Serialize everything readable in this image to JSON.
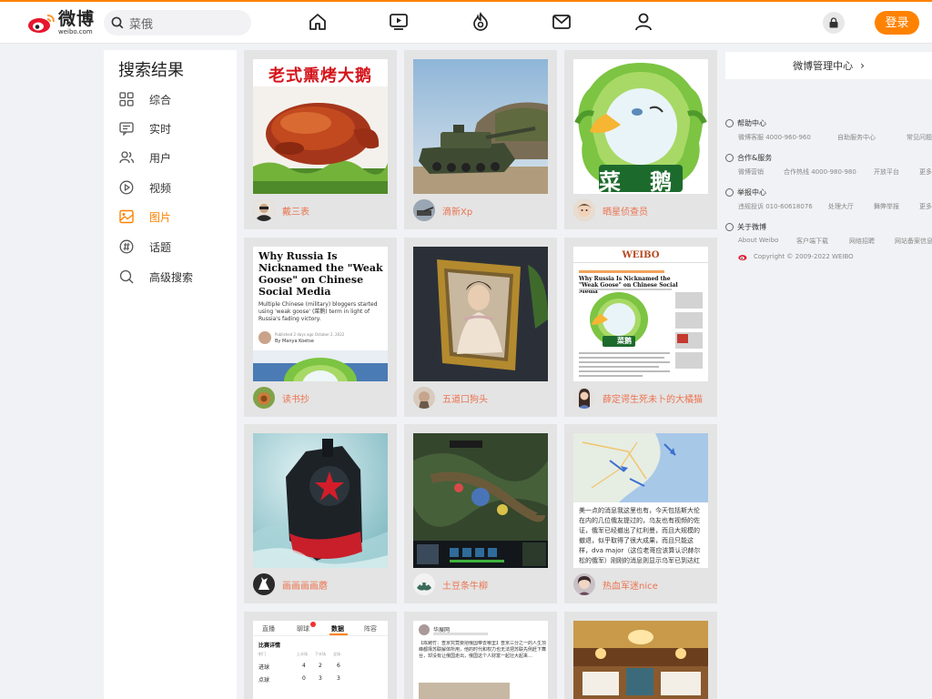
{
  "colors": {
    "accent": "#ff8200",
    "username": "#eb7350",
    "card_bg": "#e4e4e4"
  },
  "header": {
    "logo_cn": "微博",
    "logo_en": "weibo.com",
    "search_value": "菜俄",
    "nav_icons": [
      "home-icon",
      "video-icon",
      "hot-icon",
      "message-icon",
      "profile-icon"
    ],
    "login_label": "登录"
  },
  "sidebar": {
    "title": "搜索结果",
    "items": [
      {
        "label": "综合",
        "icon": "grid-icon"
      },
      {
        "label": "实时",
        "icon": "realtime-icon"
      },
      {
        "label": "用户",
        "icon": "users-icon"
      },
      {
        "label": "视频",
        "icon": "play-icon"
      },
      {
        "label": "图片",
        "icon": "image-icon",
        "active": true
      },
      {
        "label": "话题",
        "icon": "topic-icon"
      },
      {
        "label": "高级搜索",
        "icon": "advanced-search-icon"
      }
    ]
  },
  "results": [
    {
      "user": "戴三表",
      "image_text": "老式熏烤大鹅"
    },
    {
      "user": "滴新Xp"
    },
    {
      "user": "晒星侦查员",
      "image_text": "菜 鹅"
    },
    {
      "user": "读书抄",
      "image_title": "Why Russia Is Nicknamed the \"Weak Goose\" on Chinese Social Media",
      "image_body": "Multiple Chinese (military) bloggers started using 'weak goose' (菜鹅) term in light of Russia's fading victory.",
      "image_author": "By Manya Koetse",
      "image_meta": "Published 2 days ago October 2, 2022"
    },
    {
      "user": "五道口狗头"
    },
    {
      "user": "薛定谔生死未卜的大橘猫",
      "image_brand": "WEIBO",
      "image_title": "Why Russia Is Nicknamed the \"Weak Goose\" on Chinese Social Media",
      "image_text": "菜鹅"
    },
    {
      "user": "画画画画蘑"
    },
    {
      "user": "土豆条牛柳"
    },
    {
      "user": "热血军迷nice",
      "image_text": "美一点的消息我这里也有，今天包括斯大伦在内的几位俄友提过的，乌友也有视频的佐证，俄军已经撤出了红利曼，而且大规模的撤退，似乎取得了很大成果，而且只能这样，dva major（这位老哥应该算认识赫尔松的俄军）刚刚的消息则显示乌军已到达红利曼"
    },
    {
      "tabs": [
        "直播",
        "聊球",
        "数据",
        "阵容"
      ],
      "section": "比赛详情",
      "columns": [
        "射门",
        "上半场",
        "下半场",
        "全场"
      ],
      "rows": [
        [
          "进球",
          "4",
          "2",
          "6"
        ],
        [
          "点球",
          "0",
          "3",
          "3"
        ]
      ]
    },
    {
      "username": "华展网",
      "text": "【陈赌竹：查京究竟要把俄国带去哪里】查京三分之一的人生顶峰都择苏联解体所用，他的时代和权力也无法把苏联先例赶下舞台，却没有让俄国走出，俄国这个人财富一起壮大起来…"
    },
    {}
  ],
  "right": {
    "admin_center": "微博管理中心",
    "sections": [
      {
        "title": "帮助中心",
        "links": [
          "微博客服 4000-960-960",
          "自助服务中心",
          "常见问题"
        ]
      },
      {
        "title": "合作&服务",
        "links": [
          "微博营销",
          "合作热线 4000-980-980",
          "开放平台",
          "更多"
        ]
      },
      {
        "title": "举报中心",
        "links": [
          "违规投诉 010-60618076",
          "处理大厅",
          "舞弊举报",
          "更多"
        ]
      },
      {
        "title": "关于微博",
        "links": [
          "About Weibo",
          "客户端下载",
          "网络招聘",
          "网站备案信息"
        ]
      }
    ],
    "copyright": "Copyright © 2009-2022 WEIBO"
  }
}
